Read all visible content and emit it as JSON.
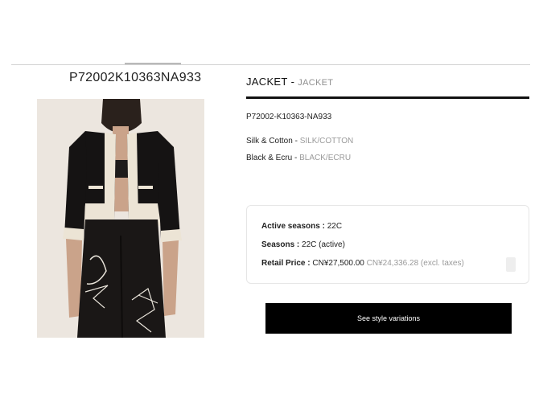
{
  "product": {
    "sku_heading": "P72002K10363NA933",
    "title": "JACKET",
    "title_separator": "-",
    "title_alt": "JACKET",
    "reference": "P72002-K10363-NA933",
    "material": "Silk & Cotton",
    "material_alt": "SILK/COTTON",
    "color": "Black & Ecru",
    "color_alt": "BLACK/ECRU",
    "attr_separator": " - "
  },
  "info": {
    "active_seasons_label": "Active seasons :",
    "active_seasons_value": "22C",
    "seasons_label": "Seasons :",
    "seasons_value": "22C (active)",
    "retail_price_label": "Retail Price :",
    "retail_price_value": "CN¥27,500.00",
    "price_excl_taxes": "CN¥24,336.28 (excl. taxes)"
  },
  "actions": {
    "variations_button_label": "See style variations"
  },
  "icons": {
    "info_box_icon": "info-icon"
  },
  "colors": {
    "button_bg": "#000000",
    "muted_text": "#9a9a9a",
    "image_bg": "#ece6df"
  }
}
